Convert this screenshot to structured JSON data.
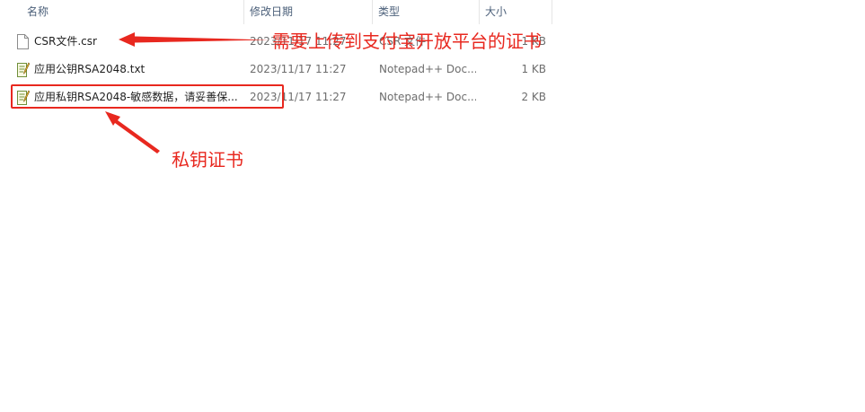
{
  "columns": {
    "name": "名称",
    "modified": "修改日期",
    "type": "类型",
    "size": "大小"
  },
  "files": [
    {
      "icon": "generic-file-icon",
      "name": "CSR文件.csr",
      "modified": "2023/11/17 11:27",
      "type": "CSR 文件",
      "size": "1 KB"
    },
    {
      "icon": "notepadpp-file-icon",
      "name": "应用公钥RSA2048.txt",
      "modified": "2023/11/17 11:27",
      "type": "Notepad++ Doc...",
      "size": "1 KB"
    },
    {
      "icon": "notepadpp-file-icon",
      "name": "应用私钥RSA2048-敏感数据，请妥善保...",
      "modified": "2023/11/17 11:27",
      "type": "Notepad++ Doc...",
      "size": "2 KB"
    }
  ],
  "annotations": {
    "csr_note": "需要上传到支付宝开放平台的证书",
    "private_key_note": "私钥证书",
    "color": "#e8281f"
  }
}
